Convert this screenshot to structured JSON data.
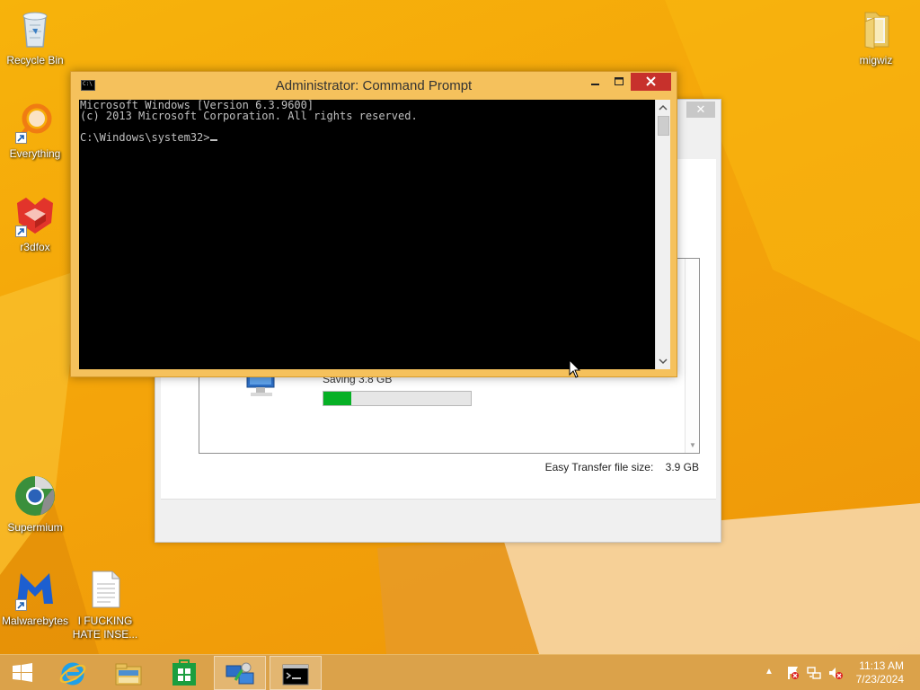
{
  "desktop": {
    "icons": [
      {
        "label": "Recycle Bin",
        "icon": "recycle-bin-icon"
      },
      {
        "label": "Everything",
        "icon": "everything-search-icon"
      },
      {
        "label": "r3dfox",
        "icon": "r3dfox-browser-icon"
      },
      {
        "label": "Supermium",
        "icon": "supermium-browser-icon"
      },
      {
        "label": "Malwarebytes",
        "icon": "malwarebytes-icon"
      },
      {
        "label": "I FUCKING HATE INSE...",
        "icon": "text-document-icon"
      },
      {
        "label": "migwiz",
        "icon": "folder-icon"
      }
    ]
  },
  "easy_transfer": {
    "status_text": "Saving 3.8 GB",
    "progress": 0.19,
    "file_size_label": "Easy Transfer file size:",
    "file_size_value": "3.9 GB",
    "close_glyph": "✕",
    "progress_color": "#06b025"
  },
  "cmd": {
    "title": "Administrator: Command Prompt",
    "icon_text": "C:\\",
    "lines": [
      "Microsoft Windows [Version 6.3.9600]",
      "(c) 2013 Microsoft Corporation. All rights reserved.",
      "",
      "C:\\Windows\\system32>"
    ],
    "close_color": "#c7312c",
    "frame_color": "#f5c15c"
  },
  "taskbar": {
    "buttons": [
      {
        "name": "start-button",
        "icon": "windows-logo-icon"
      },
      {
        "name": "internet-explorer-button",
        "icon": "internet-explorer-icon"
      },
      {
        "name": "file-explorer-button",
        "icon": "file-explorer-icon"
      },
      {
        "name": "store-button",
        "icon": "store-icon"
      },
      {
        "name": "easy-transfer-button",
        "icon": "easy-transfer-icon"
      },
      {
        "name": "command-prompt-button",
        "icon": "command-prompt-icon"
      }
    ],
    "tray": {
      "show_hidden_glyph": "▲",
      "icons": [
        "action-center-icon",
        "network-icon",
        "volume-muted-icon"
      ]
    },
    "clock": {
      "time": "11:13 AM",
      "date": "7/23/2024"
    }
  },
  "colors": {
    "wallpaper": "#f4a40a",
    "taskbar": "#dba24a"
  }
}
